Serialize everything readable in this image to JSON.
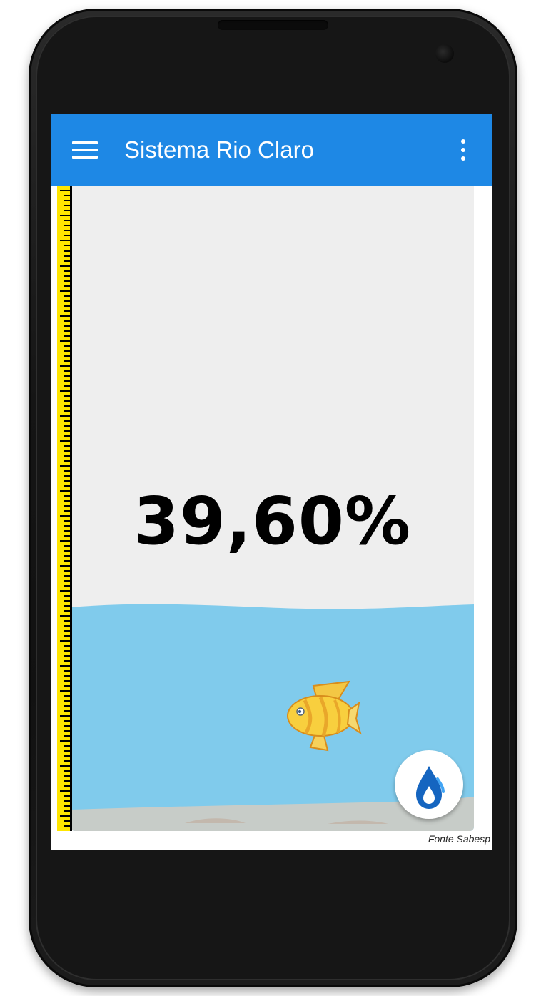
{
  "app": {
    "title": "Sistema Rio Claro",
    "menu_icon": "hamburger-menu-icon",
    "overflow_icon": "more-vert-icon"
  },
  "reservoir": {
    "level_text": "39,60%",
    "level_percent": 39.6,
    "mascot_icon": "fish-icon",
    "fab_icon": "water-drop-icon",
    "source": "Fonte Sabesp"
  },
  "colors": {
    "appbar": "#1e88e5",
    "water": "#80cbec",
    "ruler": "#ffe600",
    "tank_background": "#eeeeee"
  }
}
